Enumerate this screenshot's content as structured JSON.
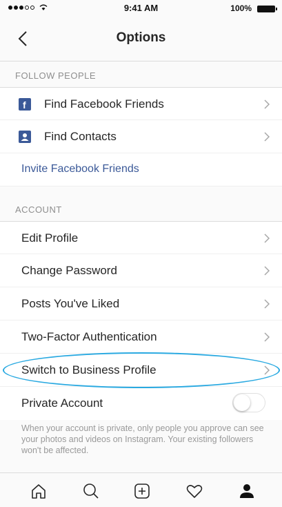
{
  "status_bar": {
    "time": "9:41 AM",
    "battery": "100%"
  },
  "header": {
    "title": "Options"
  },
  "follow_people": {
    "section_label": "FOLLOW PEOPLE",
    "items": [
      {
        "label": "Find Facebook Friends",
        "icon": "facebook-icon"
      },
      {
        "label": "Find Contacts",
        "icon": "contacts-icon"
      }
    ],
    "invite_label": "Invite Facebook Friends"
  },
  "account": {
    "section_label": "ACCOUNT",
    "items": [
      {
        "label": "Edit Profile"
      },
      {
        "label": "Change Password"
      },
      {
        "label": "Posts You've Liked"
      },
      {
        "label": "Two-Factor Authentication"
      },
      {
        "label": "Switch to Business Profile"
      }
    ],
    "private_account_label": "Private Account",
    "private_account_enabled": false,
    "private_account_help": "When your account is private, only people you approve can see your photos and videos on Instagram. Your existing followers won't be affected."
  },
  "tab_bar": {
    "tabs": [
      "home-icon",
      "search-icon",
      "add-post-icon",
      "heart-icon",
      "profile-icon"
    ]
  },
  "colors": {
    "facebook_blue": "#3b5998",
    "highlight": "#29a9e1"
  }
}
